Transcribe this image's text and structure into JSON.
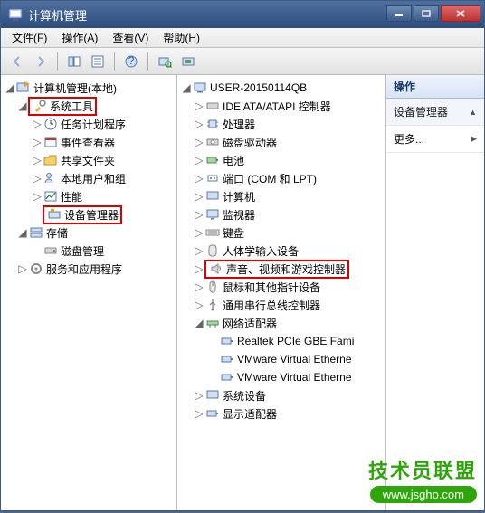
{
  "window": {
    "title": "计算机管理"
  },
  "menus": {
    "file": "文件(F)",
    "action": "操作(A)",
    "view": "查看(V)",
    "help": "帮助(H)"
  },
  "left_tree": {
    "root": "计算机管理(本地)",
    "system_tools": "系统工具",
    "task_scheduler": "任务计划程序",
    "event_viewer": "事件查看器",
    "shared_folders": "共享文件夹",
    "local_users": "本地用户和组",
    "performance": "性能",
    "device_manager": "设备管理器",
    "storage": "存储",
    "disk_mgmt": "磁盘管理",
    "services_apps": "服务和应用程序"
  },
  "mid_tree": {
    "root": "USER-20150114QB",
    "ide": "IDE ATA/ATAPI 控制器",
    "cpu": "处理器",
    "disk": "磁盘驱动器",
    "battery": "电池",
    "ports": "端口 (COM 和 LPT)",
    "computer": "计算机",
    "monitor": "监视器",
    "keyboard": "键盘",
    "hid": "人体学输入设备",
    "sound": "声音、视频和游戏控制器",
    "mouse": "鼠标和其他指针设备",
    "usb": "通用串行总线控制器",
    "network": "网络适配器",
    "net1": "Realtek PCIe GBE Fami",
    "net2": "VMware Virtual Etherne",
    "net3": "VMware Virtual Etherne",
    "system_dev": "系统设备",
    "display": "显示适配器"
  },
  "actions": {
    "header": "操作",
    "group": "设备管理器",
    "more": "更多..."
  },
  "watermark": {
    "line1": "技术员联盟",
    "line2": "www.jsgho.com"
  }
}
